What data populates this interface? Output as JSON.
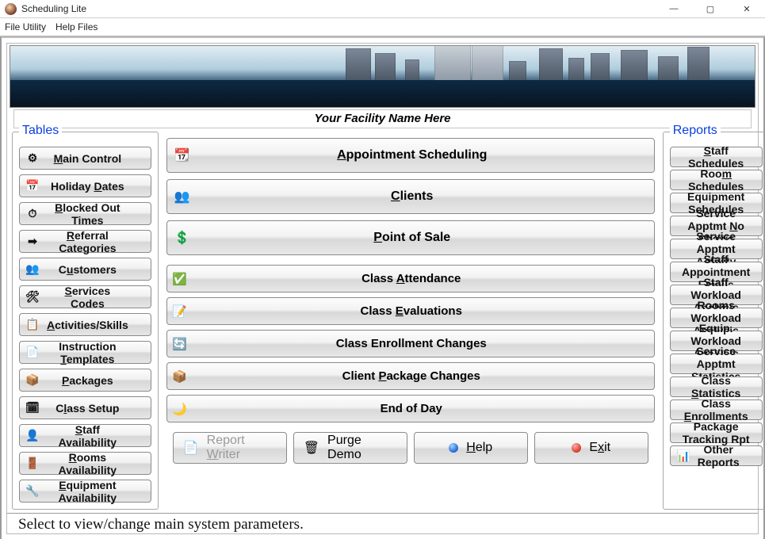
{
  "window": {
    "title": "Scheduling Lite"
  },
  "menu": {
    "file_utility": "File Utility",
    "help_files": "Help Files"
  },
  "facility_name": "Your Facility Name Here",
  "groups": {
    "tables_legend": "Tables",
    "reports_legend": "Reports"
  },
  "tables": [
    {
      "label": "Main Control",
      "u": 0,
      "icon": "main-control-icon"
    },
    {
      "label": "Holiday Dates",
      "u": 8,
      "icon": "calendar-icon"
    },
    {
      "label": "Blocked Out Times",
      "u": 0,
      "icon": "clock-block-icon"
    },
    {
      "label": "Referral Categories",
      "u": 0,
      "icon": "arrow-icon"
    },
    {
      "label": "Customers",
      "u": 1,
      "icon": "people-icon"
    },
    {
      "label": "Services Codes",
      "u": 0,
      "icon": "tools-icon"
    },
    {
      "label": "Activities/Skills",
      "u": 0,
      "icon": "list-icon"
    },
    {
      "label": "Instruction Templates",
      "u": 12,
      "icon": "doc-icon"
    },
    {
      "label": "Packages",
      "u": 0,
      "icon": "box-icon"
    },
    {
      "label": "Class Setup",
      "u": 1,
      "icon": "class-icon"
    },
    {
      "label": "Staff Availability",
      "u": 0,
      "icon": "staff-icon"
    },
    {
      "label": "Rooms Availability",
      "u": 0,
      "icon": "room-icon"
    },
    {
      "label": "Equipment Availability",
      "u": 0,
      "icon": "equipment-icon"
    }
  ],
  "center_big": [
    {
      "label": "Appointment Scheduling",
      "u": 0,
      "icon": "schedule-icon"
    },
    {
      "label": "Clients",
      "u": 0,
      "icon": "clients-icon"
    },
    {
      "label": "Point of Sale",
      "u": 0,
      "icon": "money-icon"
    }
  ],
  "center_mid": [
    {
      "label": "Class Attendance",
      "u": 6,
      "icon": "attend-icon"
    },
    {
      "label": "Class Evaluations",
      "u": 6,
      "icon": "eval-icon"
    },
    {
      "label": "Class Enrollment Changes",
      "u": -1,
      "icon": "enroll-change-icon"
    },
    {
      "label": "Client Package Changes",
      "u": 7,
      "icon": "pkg-change-icon"
    },
    {
      "label": "End of Day",
      "u": -1,
      "icon": "eod-icon"
    }
  ],
  "reports": [
    {
      "label": "Staff Schedules",
      "u": 0
    },
    {
      "label": "Room Schedules",
      "u": 3
    },
    {
      "label": "Equipment Schedules",
      "u": -1
    },
    {
      "label": "Service Apptmt No Shows",
      "u": 15
    },
    {
      "label": "Service Apptmt Activity",
      "u": -1
    },
    {
      "label": "Staff Appointment Emails",
      "u": -1
    },
    {
      "label": "Staff Workload Analysis",
      "u": -1
    },
    {
      "label": "Rooms Workload Analysis",
      "u": -1
    },
    {
      "label": "Equip. Workload Analysis",
      "u": -1
    },
    {
      "label": "Service Apptmt Statistics",
      "u": -1
    },
    {
      "label": "Class Statistics",
      "u": 6
    },
    {
      "label": "Class Enrollments",
      "u": 6
    },
    {
      "label": "Package Tracking Rpt",
      "u": -1
    },
    {
      "label": "Other Reports",
      "u": -1,
      "icon": "report-icon"
    }
  ],
  "actions": {
    "report_writer": "Report Writer",
    "purge_demo": "Purge Demo",
    "help": "Help",
    "exit": "Exit"
  },
  "status_text": "Select to view/change main system parameters."
}
